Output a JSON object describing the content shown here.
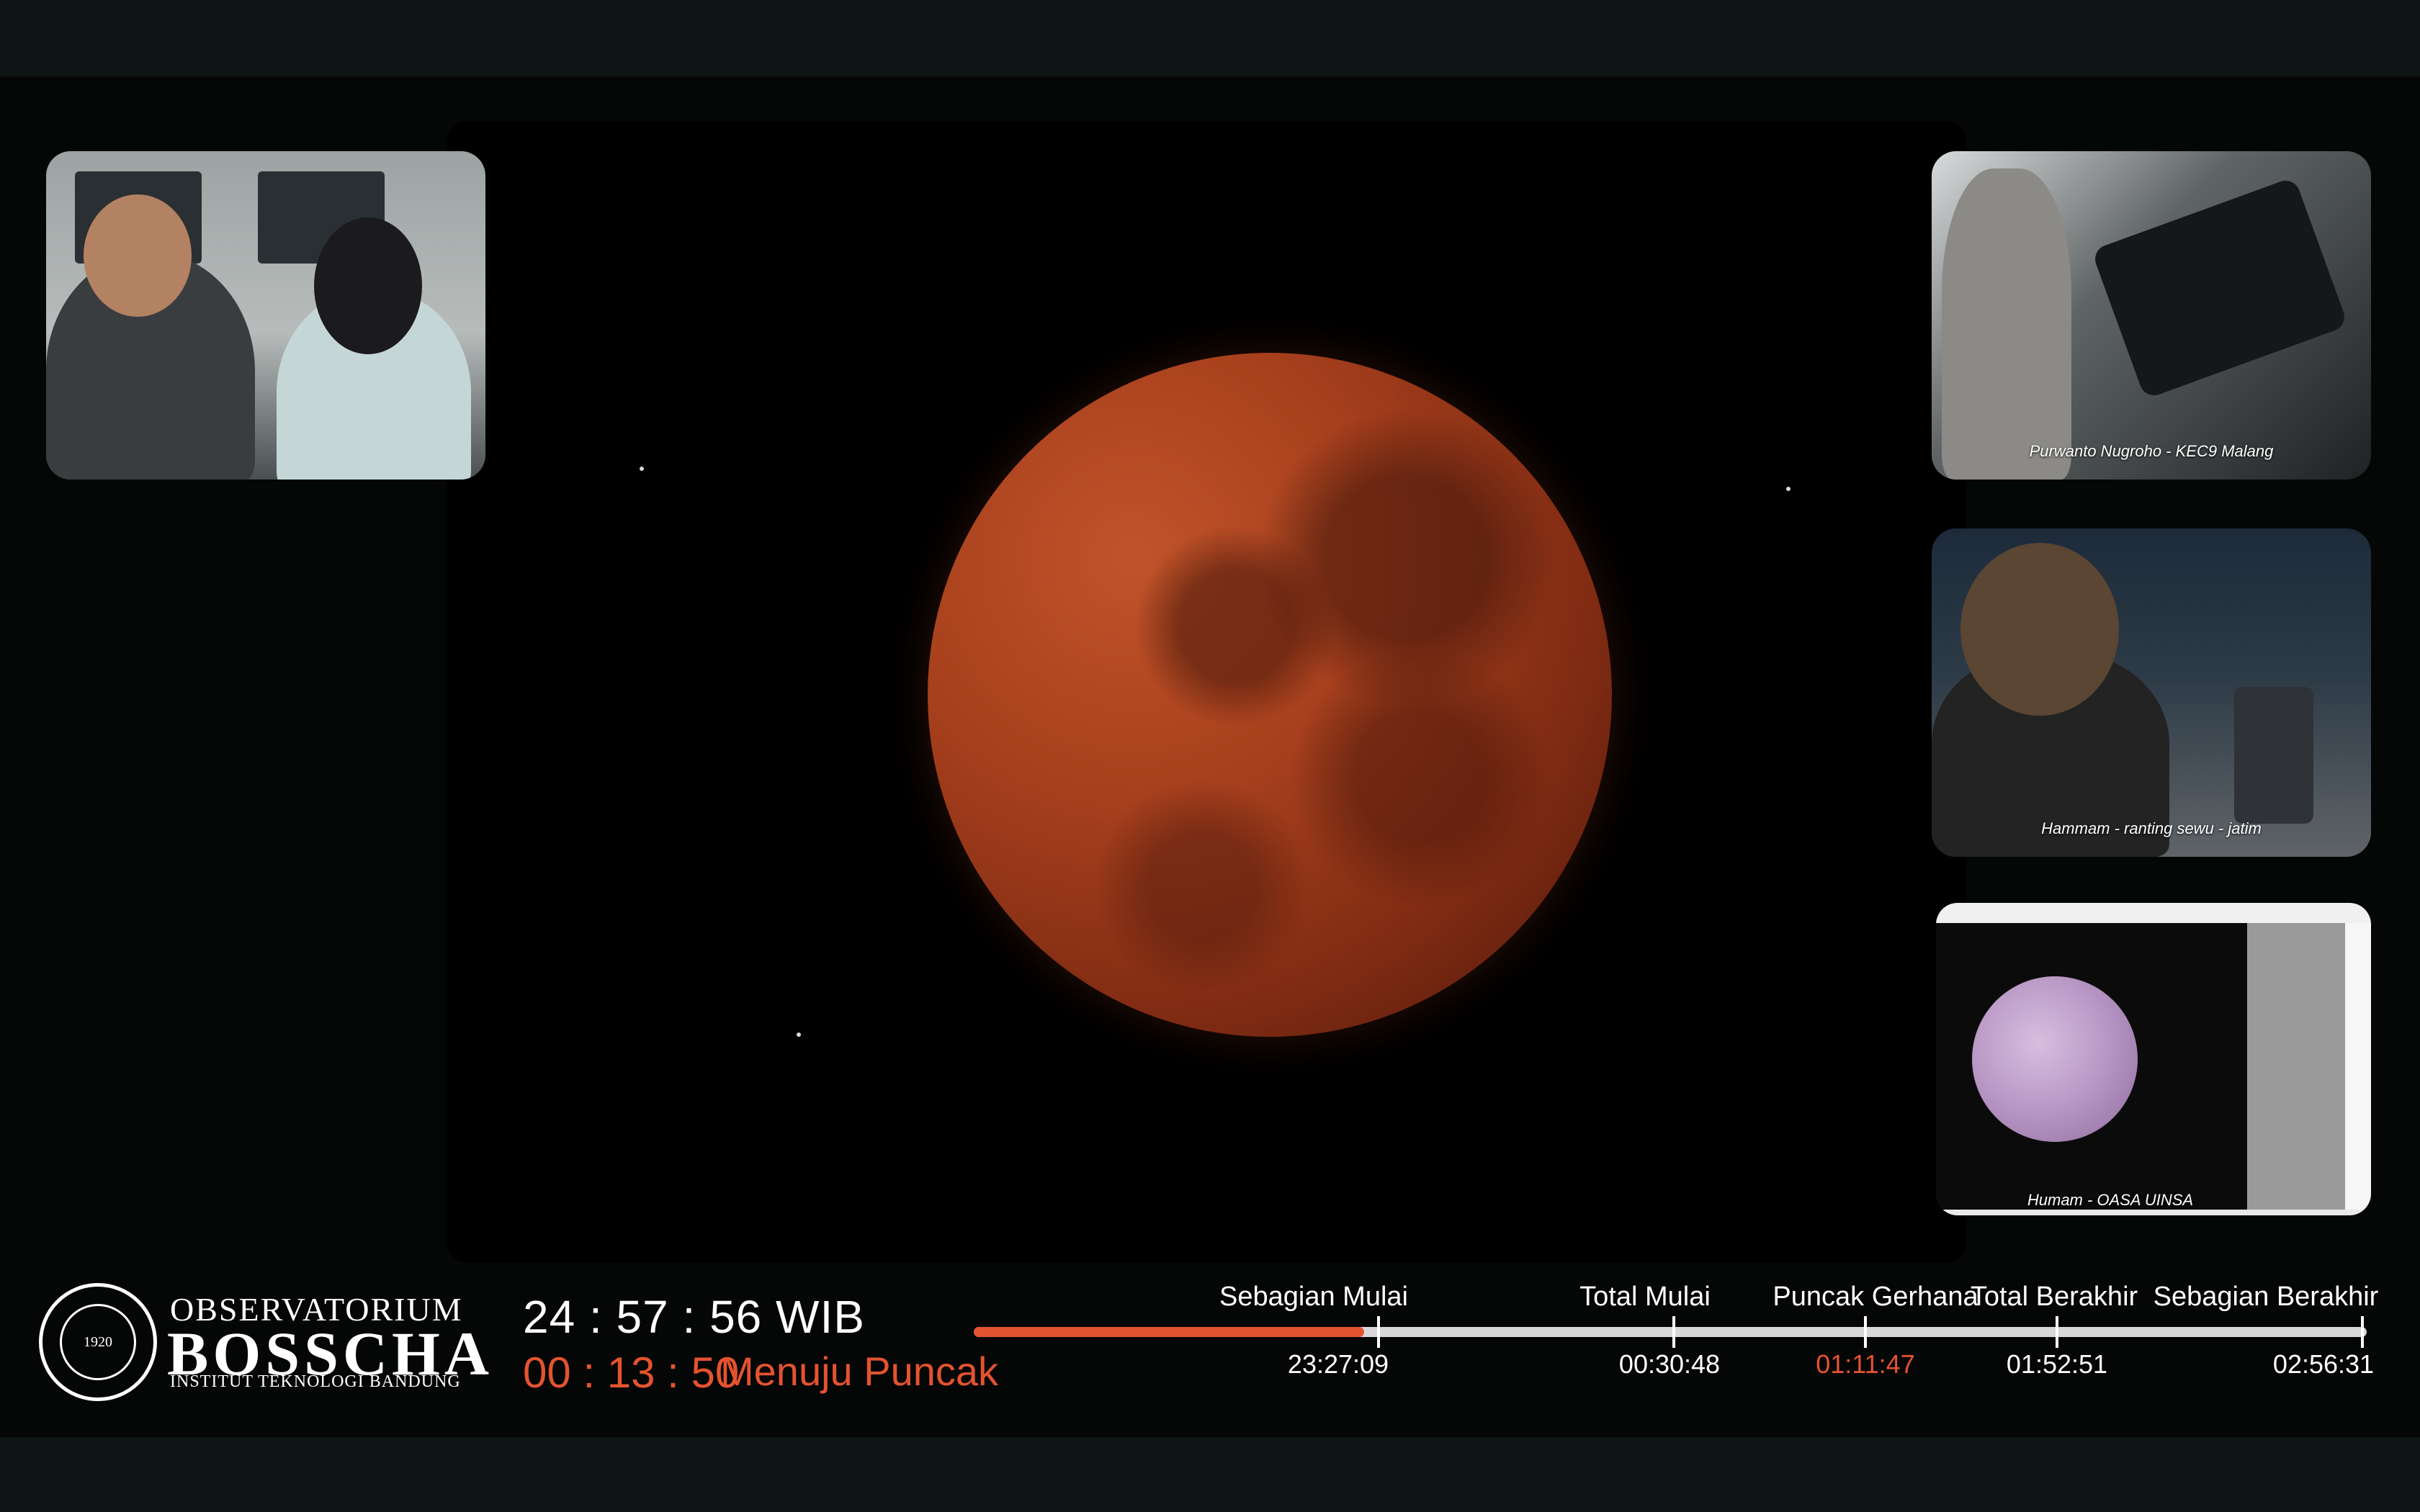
{
  "brand": {
    "line1": "OBSERVATORIUM",
    "line2": "BOSSCHA",
    "line3": "INSTITUT TEKNOLOGI BANDUNG",
    "seal_year": "1920"
  },
  "clock": {
    "time": "24 : 57 : 56",
    "zone": "WIB"
  },
  "countdown": {
    "value": "00 : 13 : 50",
    "status": "Menuju Puncak"
  },
  "timeline": {
    "progress_fraction": 0.28,
    "phases": [
      {
        "label": "Sebagian Mulai",
        "time": "23:27:09"
      },
      {
        "label": "Total Mulai",
        "time": "00:30:48"
      },
      {
        "label": "Puncak Gerhana",
        "time": "01:11:47",
        "active": true
      },
      {
        "label": "Total Berakhir",
        "time": "01:52:51"
      },
      {
        "label": "Sebagian Berakhir",
        "time": "02:56:31"
      }
    ]
  },
  "cameras": [
    {
      "label": ""
    },
    {
      "label": "Purwanto Nugroho - KEC9 Malang"
    },
    {
      "label": "Hammam - ranting sewu - jatim"
    },
    {
      "label": "Humam - OASA UINSA"
    }
  ],
  "colors": {
    "accent": "#e4532f",
    "track": "#d8d8d8",
    "background": "#050606"
  }
}
